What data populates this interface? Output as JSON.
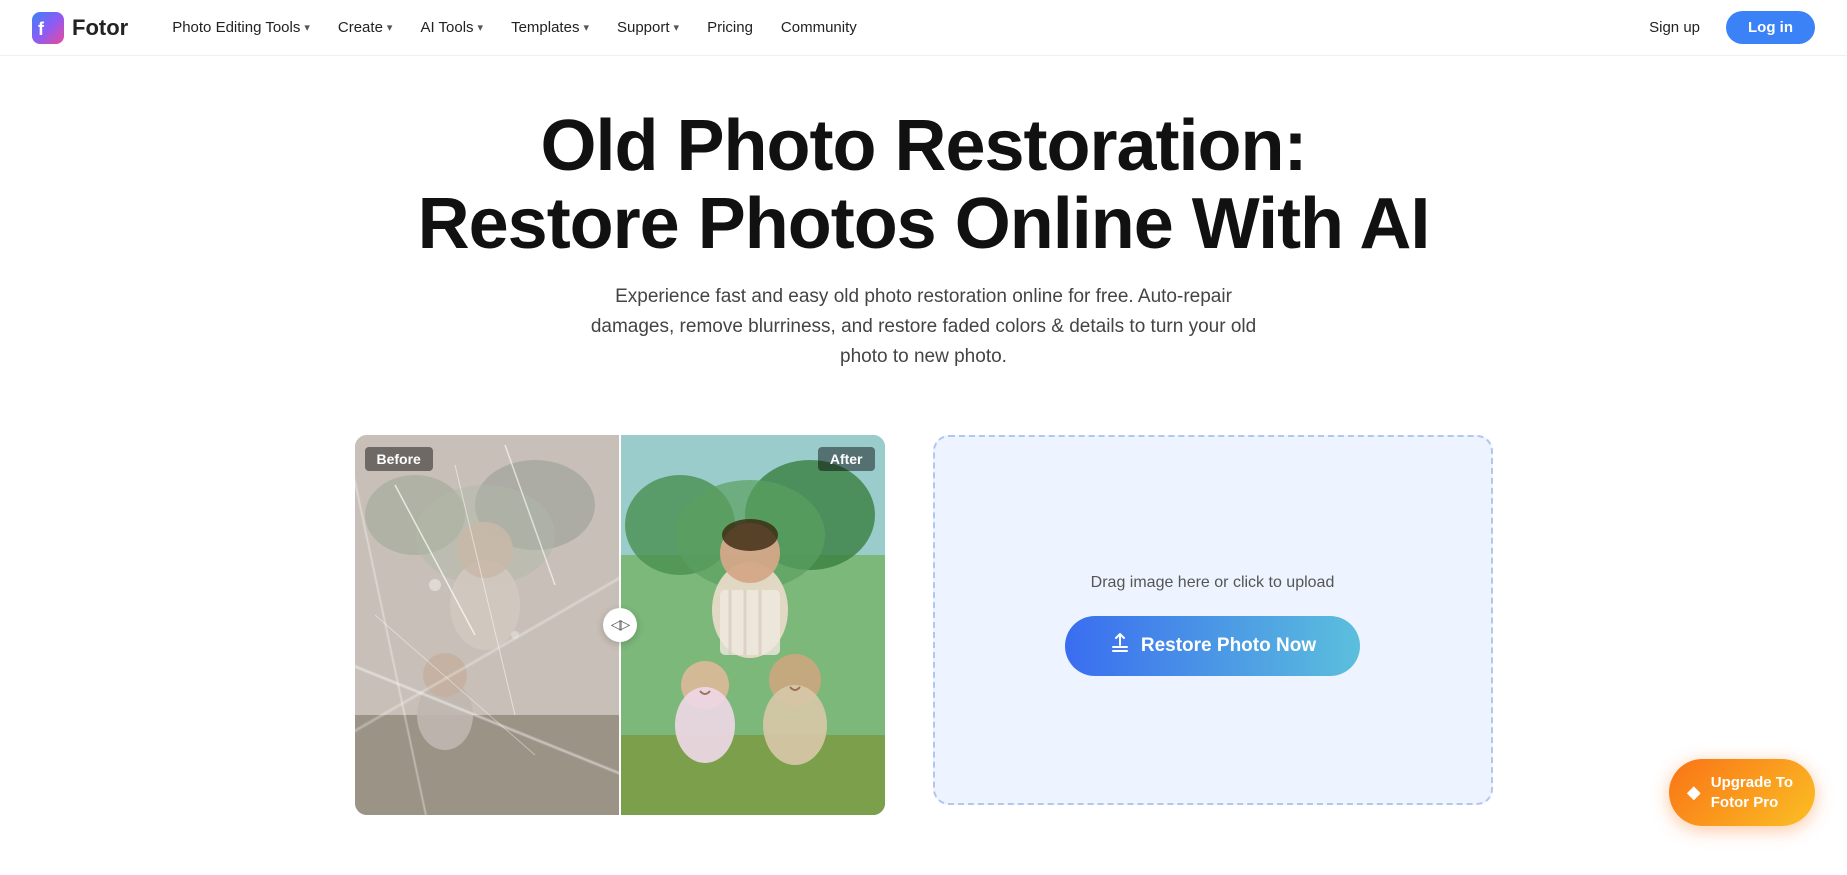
{
  "logo": {
    "name": "Fotor",
    "icon_label": "fotor-logo-icon"
  },
  "nav": {
    "items": [
      {
        "label": "Photo Editing Tools",
        "has_dropdown": true
      },
      {
        "label": "Create",
        "has_dropdown": true
      },
      {
        "label": "AI Tools",
        "has_dropdown": true
      },
      {
        "label": "Templates",
        "has_dropdown": true
      },
      {
        "label": "Support",
        "has_dropdown": true
      },
      {
        "label": "Pricing",
        "has_dropdown": false
      },
      {
        "label": "Community",
        "has_dropdown": false
      }
    ],
    "sign_up": "Sign up",
    "log_in": "Log in"
  },
  "hero": {
    "title_line1": "Old Photo Restoration:",
    "title_line2": "Restore Photos Online With AI",
    "description": "Experience fast and easy old photo restoration online for free. Auto-repair damages, remove blurriness, and restore faded colors & details to turn your old photo to new photo."
  },
  "before_after": {
    "before_label": "Before",
    "after_label": "After"
  },
  "upload": {
    "drag_text": "Drag image here or click to upload",
    "button_label": "Restore Photo Now"
  },
  "upgrade": {
    "line1": "Upgrade To",
    "line2": "Fotor Pro"
  }
}
